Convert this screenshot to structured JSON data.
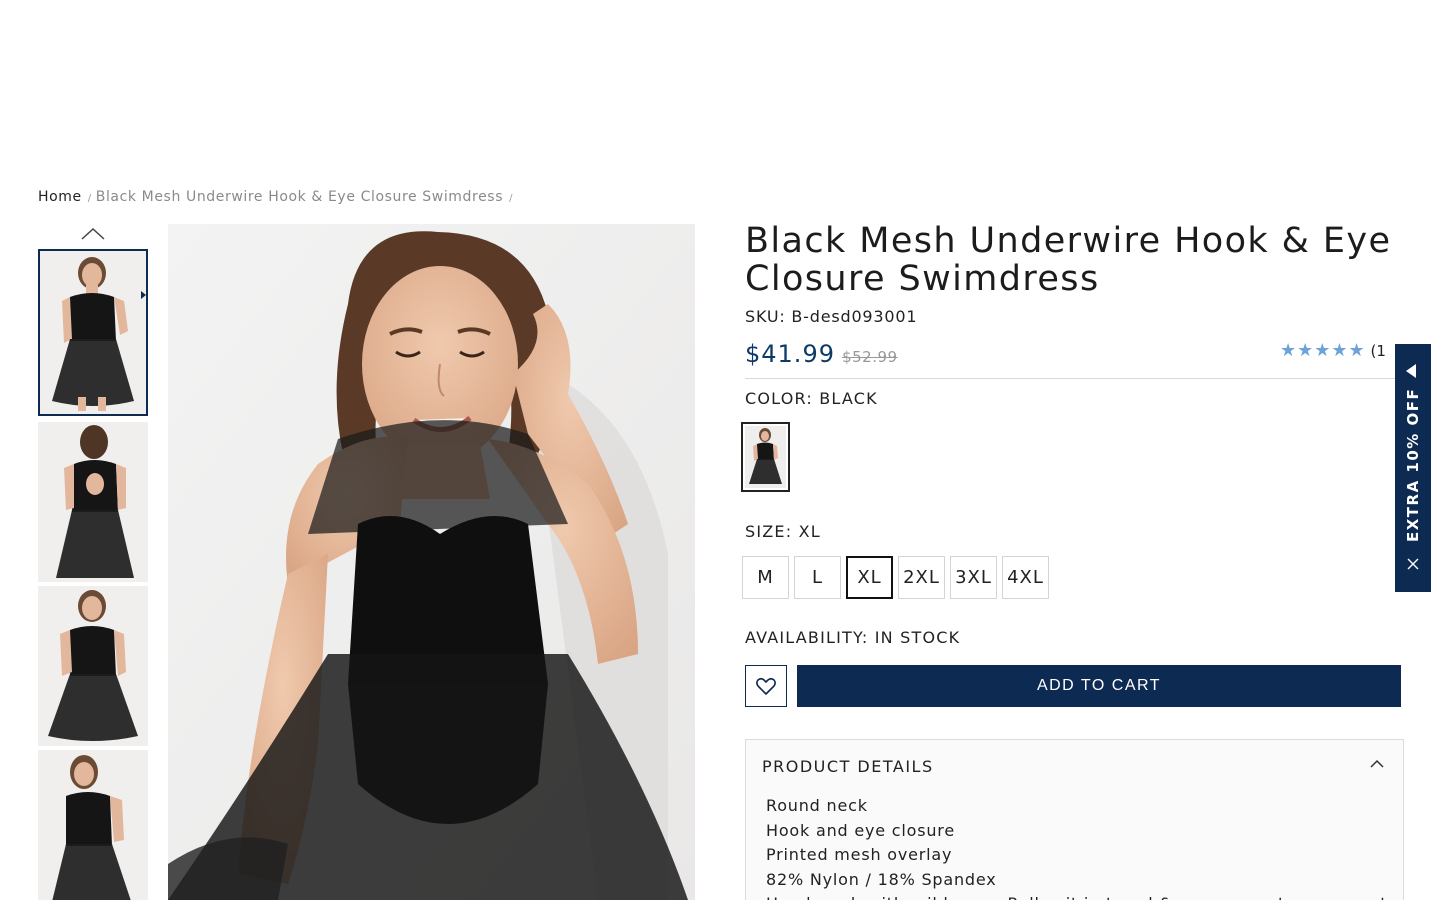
{
  "breadcrumb": {
    "home": "Home",
    "separator": "/",
    "current": "Black Mesh Underwire Hook & Eye Closure Swimdress",
    "trailing_separator": "/"
  },
  "product": {
    "title": "Black Mesh Underwire Hook & Eye Closure Swimdress",
    "sku": "SKU: B-desd093001",
    "price": "$41.99",
    "old_price": "$52.99",
    "rating_stars": "★★★★★",
    "rating_count": "(1",
    "color_label": "COLOR: BLACK",
    "size_label": "SIZE: XL",
    "sizes": [
      "M",
      "L",
      "XL",
      "2XL",
      "3XL",
      "4XL"
    ],
    "selected_size": "XL",
    "availability": "AVAILABILITY: IN STOCK",
    "add_to_cart": "ADD TO CART"
  },
  "details": {
    "header": "PRODUCT DETAILS",
    "items": [
      "Round neck",
      "Hook and eye closure",
      "Printed mesh overlay",
      "82% Nylon / 18% Spandex",
      "Hand wash with mild soap. Roll suit in towel & squeeze out excess water"
    ]
  },
  "promo": {
    "text": "EXTRA 10% OFF"
  },
  "colors": {
    "navy": "#0d2a52",
    "price": "#0d3a66",
    "star": "#6fa3d8"
  },
  "icons": {
    "thumb_up": "chevron-up-icon",
    "wishlist": "heart-icon",
    "details_toggle": "chevron-up-icon",
    "promo_expand": "triangle-left-icon",
    "promo_close": "close-icon"
  }
}
